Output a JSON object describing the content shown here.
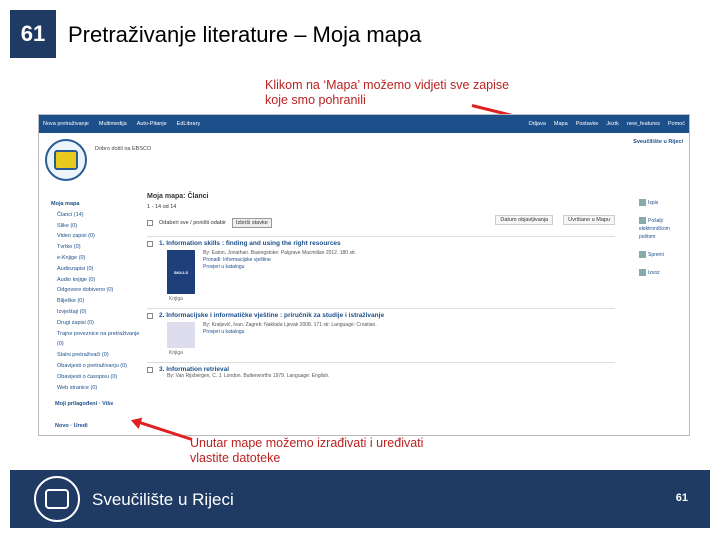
{
  "slide": {
    "number": "61",
    "title": "Pretraživanje literature – Moja mapa",
    "callout_top": "Klikom na ‘Mapa’ možemo vidjeti sve zapise koje smo pohranili",
    "callout_bottom": "Unutar mape možemo izrađivati i uređivati vlastite datoteke",
    "footer_name": "Sveučilište u Rijeci",
    "footer_number": "61"
  },
  "app": {
    "nav": [
      "Nova pretraživanje",
      "Multimedija",
      "Auto-Pitanje",
      "EdLibrary"
    ],
    "nav_right": [
      "Odjava",
      "Mapa",
      "Postavke",
      "Jezik",
      "new_features",
      "Pomoć"
    ],
    "welcome": "Dobro došli na EBSCO",
    "university_link": "Sveučilište u Rijeci",
    "sidebar": {
      "head": "Moja mapa",
      "items": [
        "Članci (14)",
        "Slike (0)",
        "Video zapisi (0)",
        "Tvrtke (0)",
        "e-Knjige (0)",
        "Audiozapisi (0)",
        "Audio knjige (0)",
        "Odgovore dobiveno (0)",
        "Bilješke (0)",
        "Izvještaji (0)",
        "Drugi zapisi (0)",
        "Trajne poveznice na pretraživanje (0)",
        "Stalni pretraživači (0)",
        "Obavijesti o pretraživanju (0)",
        "Obavijesti o časopisu (0)",
        "Web stranice (0)"
      ],
      "folders_label": "Moji prilagođeni",
      "more_label": "Više",
      "new_label": "Novo",
      "edit_label": "Uredi"
    },
    "main": {
      "title": "Moja mapa: Članci",
      "count": "1 - 14 od 14",
      "sort1": "Datum objavljivanja",
      "sort2": "Uvrštano u Mapu",
      "select_label": "Odaberi sve / poništi odabir",
      "delete_btn": "Izbriši stavke",
      "records": [
        {
          "title": "1. Information skills : finding and using the right resources",
          "meta": "By: Eaton, Jonathan. Basingstoke: Palgrave Macmillan 2012. 180 str.",
          "link": "Pronađi: Informacijske vještine",
          "link2": "Provjeri u katalogu",
          "kind": "Knjiga",
          "cover": "SKILLS"
        },
        {
          "title": "2. Informacijske i informatičke vještine : priručnik za studije i istraživanje",
          "meta": "By: Kraljević, Ivan. Zagreb: Naklada Ljevak 2008. 171 str. Language: Croatian.",
          "link": "Provjeri u katalogu",
          "kind": "Knjiga",
          "cover": ""
        },
        {
          "title": "3. Information retrieval",
          "meta": "By: Van Rijsbergen, C. J. London. Butterworths 1979. Language: English.",
          "kind": "",
          "cover": ""
        }
      ]
    },
    "right_panel": [
      "Ispis",
      "Pošalji elektroničkom poštom",
      "Spremi",
      "Izvoz"
    ]
  }
}
